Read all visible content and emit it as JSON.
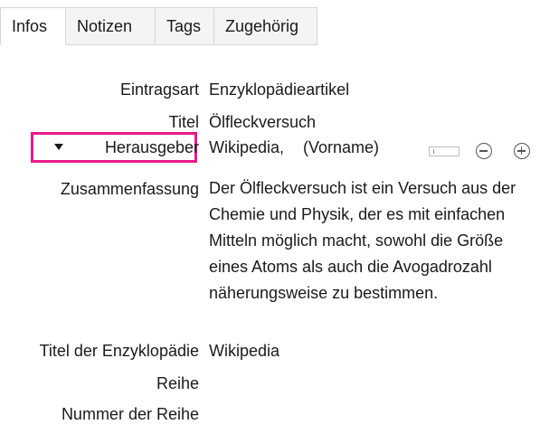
{
  "tabs": [
    {
      "label": "Infos",
      "active": true
    },
    {
      "label": "Notizen",
      "active": false
    },
    {
      "label": "Tags",
      "active": false
    },
    {
      "label": "Zugehörig",
      "active": false
    }
  ],
  "fields": {
    "itemType": {
      "label": "Eintragsart",
      "value": "Enzyklopädieartikel"
    },
    "title": {
      "label": "Titel",
      "value": "Ölfleckversuch"
    },
    "editor": {
      "label": "Herausgeber",
      "last": "Wikipedia,",
      "first": "(Vorname)"
    },
    "abstract": {
      "label": "Zusammenfassung",
      "value": "Der Ölfleckversuch ist ein Versuch aus der Chemie und Physik, der es mit einfachen Mitteln möglich macht, sowohl die Größe eines Atoms als auch die Avogadrozahl näherungsweise zu bestimmen."
    },
    "encyclopediaTitle": {
      "label": "Titel der Enzyklopädie",
      "value": "Wikipedia"
    },
    "series": {
      "label": "Reihe",
      "value": ""
    },
    "seriesNumber": {
      "label": "Nummer der Reihe",
      "value": ""
    }
  },
  "colors": {
    "highlight": "#e8198b",
    "tabBorder": "#d6d6d6",
    "tabInactive": "#f4f4f4"
  },
  "icons": {
    "disclosure": "triangle-down-icon",
    "toggle": "creator-mode-toggle-icon",
    "remove": "minus-circle-icon",
    "add": "plus-circle-icon"
  }
}
